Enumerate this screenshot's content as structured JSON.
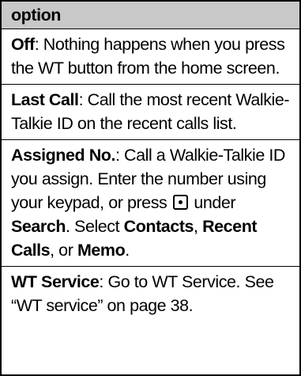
{
  "header": {
    "title": "option"
  },
  "rows": [
    {
      "term": "Off",
      "sep": ":",
      "desc": " Nothing happens when you press the WT button from the home screen."
    },
    {
      "term": "Last Call",
      "sep": ":",
      "desc": " Call the most recent Walkie-Talkie ID on the recent calls list."
    },
    {
      "term": "Assigned No.",
      "sep": ":",
      "desc1": " Call a Walkie-Talkie ID you assign. Enter the number using your keypad, or press ",
      "key_icon": "center-select-key-icon",
      "desc2": " under ",
      "b1": "Search",
      "desc3": ". Select ",
      "b2": "Contacts",
      "desc4": ", ",
      "b3": "Recent Calls",
      "desc5": ", or ",
      "b4": "Memo",
      "desc6": "."
    },
    {
      "term": "WT Service",
      "sep": ":",
      "desc": " Go to WT Service. See “WT service” on page 38."
    }
  ]
}
